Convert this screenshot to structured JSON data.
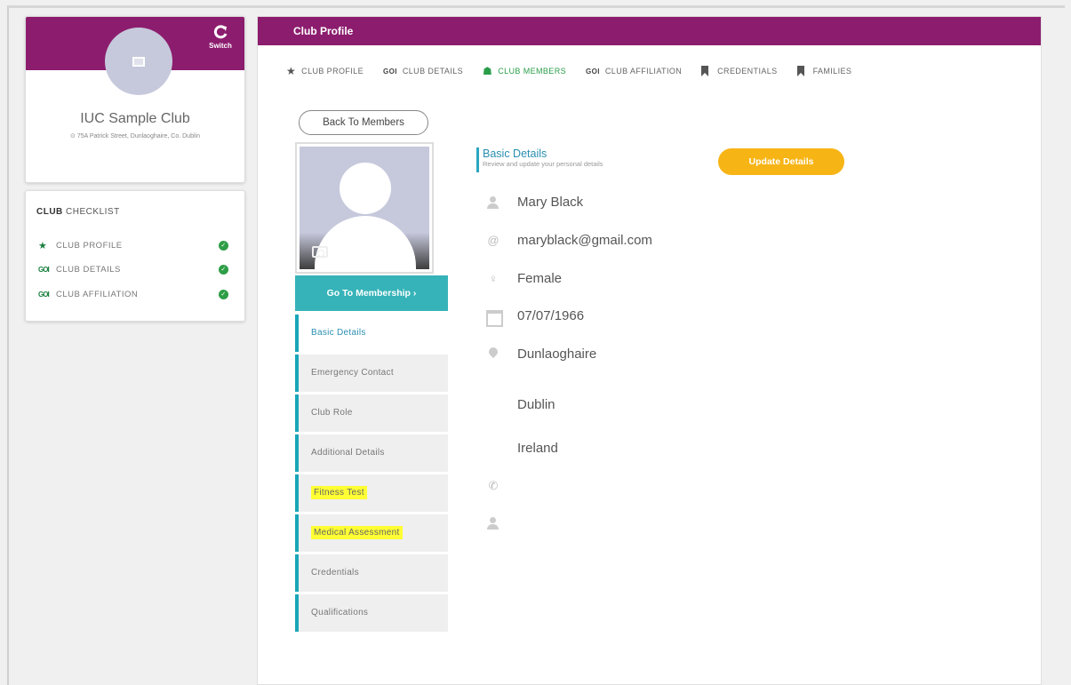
{
  "left_card": {
    "switch_label": "Switch",
    "club_name": "IUC Sample Club",
    "club_address": "75A Patrick Street, Dunlaoghaire, Co. Dublin"
  },
  "checklist": {
    "title_bold": "CLUB",
    "title_rest": " CHECKLIST",
    "items": [
      {
        "label": "CLUB PROFILE",
        "icon": "star-icon"
      },
      {
        "label": "CLUB DETAILS",
        "icon": "goi-icon"
      },
      {
        "label": "CLUB AFFILIATION",
        "icon": "goi-icon"
      }
    ]
  },
  "main": {
    "header_title": "Club Profile",
    "tabs": [
      {
        "label": "CLUB PROFILE",
        "icon": "star-icon"
      },
      {
        "label": "CLUB DETAILS",
        "icon": "goi-icon"
      },
      {
        "label": "CLUB MEMBERS",
        "icon": "members-icon",
        "active": true
      },
      {
        "label": "CLUB AFFILIATION",
        "icon": "goi-icon"
      },
      {
        "label": "CREDENTIALS",
        "icon": "bookmark-icon"
      },
      {
        "label": "FAMILIES",
        "icon": "bookmark-icon"
      }
    ],
    "goi_text": "GOI",
    "back_button": "Back To Members",
    "membership_button": "Go To Membership ›",
    "menu": [
      {
        "label": "Basic Details",
        "active": true
      },
      {
        "label": "Emergency Contact"
      },
      {
        "label": "Club Role"
      },
      {
        "label": "Additional Details"
      },
      {
        "label": "Fitness Test",
        "highlight": true
      },
      {
        "label": "Medical Assessment",
        "highlight": true
      },
      {
        "label": "Credentials"
      },
      {
        "label": "Qualifications"
      }
    ],
    "basic_details": {
      "title": "Basic Details",
      "subtitle": "Review and update your personal details",
      "update_button": "Update Details",
      "name": "Mary Black",
      "email": "maryblack@gmail.com",
      "gender": "Female",
      "dob": "07/07/1966",
      "address_line1": "Dunlaoghaire",
      "address_line2": "Dublin",
      "address_line3": "Ireland"
    }
  },
  "colors": {
    "brand_purple": "#8c1d6e",
    "teal": "#36b3b8",
    "accent_yellow": "#f7b415",
    "active_green": "#2a9d4a",
    "highlight": "#ffff33"
  }
}
